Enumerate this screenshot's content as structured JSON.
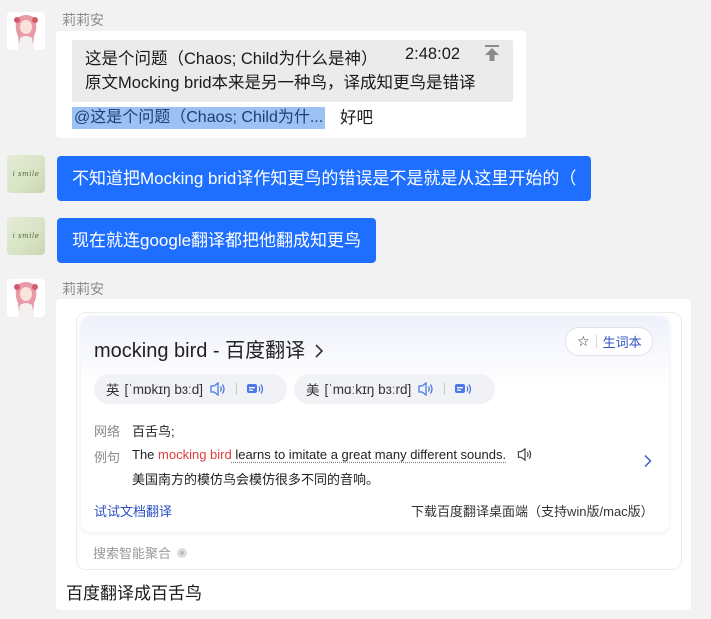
{
  "messages": {
    "m1": {
      "sender": "莉莉安",
      "quote_line1": "这是个问题（Chaos; Child为什么是神）",
      "quote_time": "2:48:02",
      "quote_line2": "原文Mocking brid本来是另一种鸟，译成知更鸟是错译",
      "mention": "@这是个问题（Chaos; Child为什...",
      "reply": "好吧"
    },
    "m2": {
      "text": "不知道把Mocking brid译作知更鸟的错误是不是就是从这里开始的（"
    },
    "m3": {
      "text": "现在就连google翻译都把他翻成知更鸟"
    },
    "m4": {
      "sender": "莉莉安",
      "card": {
        "title": "mocking bird - 百度翻译",
        "vocab_button": "生词本",
        "pron_uk_label": "英",
        "pron_uk_ipa": "[ˈmɒkɪŋ bɜːd]",
        "pron_us_label": "美",
        "pron_us_ipa": "[ˈmɑːkɪŋ bɜːrd]",
        "web_label": "网络",
        "web_text": "百舌鸟;",
        "example_label": "例句",
        "example_pre": "The ",
        "example_hl": "mocking bird",
        "example_post": " learns to imitate a great many different sounds.",
        "example_translation": "美国南方的模仿鸟会模仿很多不同的音响。",
        "doc_link": "试试文档翻译",
        "download_link": "下载百度翻译桌面端（支持win版/mac版）"
      },
      "footer": "搜索智能聚合",
      "text": "百度翻译成百舌鸟"
    }
  },
  "colors": {
    "bubble_blue": "#1e6fff",
    "mention_bg": "#9cc1f3",
    "highlight_red": "#e23b3b",
    "link_blue": "#2c4fc4"
  },
  "icons": [
    "up-arrow-icon",
    "star-icon",
    "speaker-icon",
    "ai-voice-icon",
    "chevron-right-icon"
  ]
}
